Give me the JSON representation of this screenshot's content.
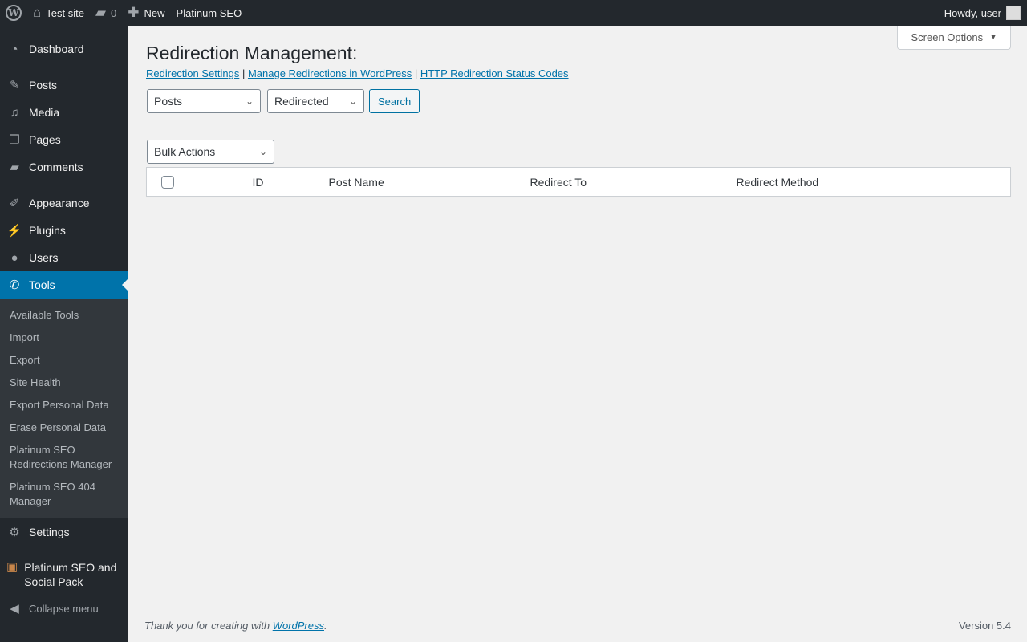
{
  "adminbar": {
    "site": "Test site",
    "comments": "0",
    "new": "New",
    "plugin": "Platinum SEO",
    "howdy": "Howdy, user"
  },
  "sidebar": {
    "items": [
      {
        "label": "Dashboard",
        "icon": "◔"
      },
      {
        "label": "Posts",
        "icon": "✎"
      },
      {
        "label": "Media",
        "icon": "♫"
      },
      {
        "label": "Pages",
        "icon": "❐"
      },
      {
        "label": "Comments",
        "icon": "▰"
      },
      {
        "label": "Appearance",
        "icon": "✐"
      },
      {
        "label": "Plugins",
        "icon": "⚡"
      },
      {
        "label": "Users",
        "icon": "●"
      },
      {
        "label": "Tools",
        "icon": "✆"
      }
    ],
    "submenu": [
      "Available Tools",
      "Import",
      "Export",
      "Site Health",
      "Export Personal Data",
      "Erase Personal Data",
      "Platinum SEO Redirections Manager",
      "Platinum SEO 404 Manager"
    ],
    "settings": "Settings",
    "platinum": "Platinum SEO and Social Pack",
    "collapse": "Collapse menu"
  },
  "screen_options": "Screen Options",
  "main": {
    "title": "Redirection Management:",
    "links": [
      "Redirection Settings",
      "Manage Redirections in WordPress",
      "HTTP Redirection Status Codes"
    ],
    "post_type": "Posts",
    "status": "Redirected",
    "search": "Search",
    "bulk": "Bulk Actions",
    "columns": [
      "ID",
      "Post Name",
      "Redirect To",
      "Redirect Method"
    ]
  },
  "footer": {
    "thanks": "Thank you for creating with ",
    "wp": "WordPress",
    "version": "Version 5.4"
  }
}
